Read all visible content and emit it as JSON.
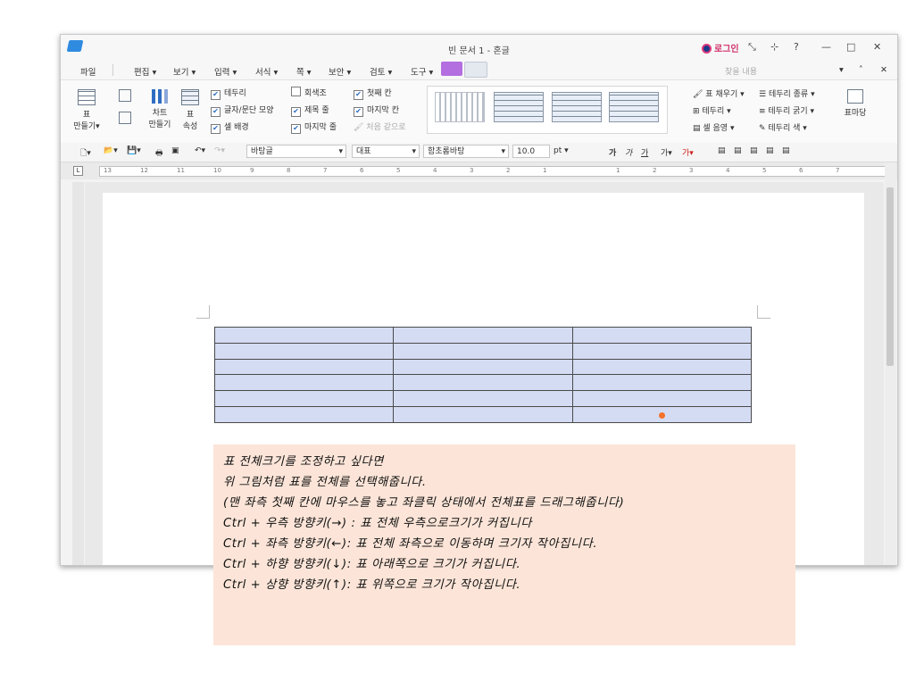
{
  "window": {
    "title": "빈 문서 1 - 혼글",
    "login": "로그인",
    "controls": [
      "?",
      "—",
      "□",
      "✕"
    ]
  },
  "menu": {
    "items": [
      "파일",
      "편집",
      "보기",
      "입력",
      "서식",
      "쪽",
      "보안",
      "검토",
      "도구"
    ],
    "search_placeholder": "찾을 내용"
  },
  "ribbon": {
    "table_make": "표\n만들기",
    "chart_make": "차트\n만들기",
    "table_props": "표\n속성",
    "checks": [
      "테두리",
      "글자/문단 모양",
      "셀 배경",
      "회색조",
      "제목 줄",
      "마지막 줄",
      "첫째 칸",
      "마지막 칸",
      "처음 같으로"
    ],
    "fill": "표 채우기",
    "border": "테두리",
    "cell_shade": "셀 음영",
    "border_type": "테두리 종류",
    "border_width": "테두리 굵기",
    "border_color": "테두리 색",
    "table_mark": "표마당"
  },
  "toolbar": {
    "style": "바탕글",
    "lang": "대표",
    "font": "함초롬바탕",
    "size": "10.0",
    "unit": "pt"
  },
  "ruler": {
    "numbers": [
      "13",
      "12",
      "11",
      "10",
      "9",
      "8",
      "7",
      "6",
      "5",
      "4",
      "3",
      "2",
      "1",
      "",
      "1",
      "2",
      "3",
      "4",
      "5",
      "6",
      "7"
    ]
  },
  "table": {
    "rows": 6,
    "cols": 3
  },
  "note": {
    "lines": [
      "표 전체크기를 조정하고 싶다면",
      "위 그림처럼 표를 전체를 선택해줍니다.",
      "(맨 좌측 첫째 칸에 마우스를 놓고 좌클릭 상태에서 전체표를 드래그해줍니다)",
      "Ctrl + 우측 방향키(→) : 표 전체 우측으로크기가 커집니다",
      "Ctrl + 좌측 방향키(←): 표 전체 좌측으로 이동하며 크기자 작아집니다.",
      "Ctrl + 하향 방향키(↓): 표 아래쪽으로 크기가 커집니다.",
      "Ctrl + 상향 방향키(↑): 표 위쪽으로 크기가 작아집니다."
    ]
  },
  "colors": {
    "table_fill": "#d4dcf3",
    "note_bg": "#fce5d8",
    "accent": "#2f8be0"
  }
}
